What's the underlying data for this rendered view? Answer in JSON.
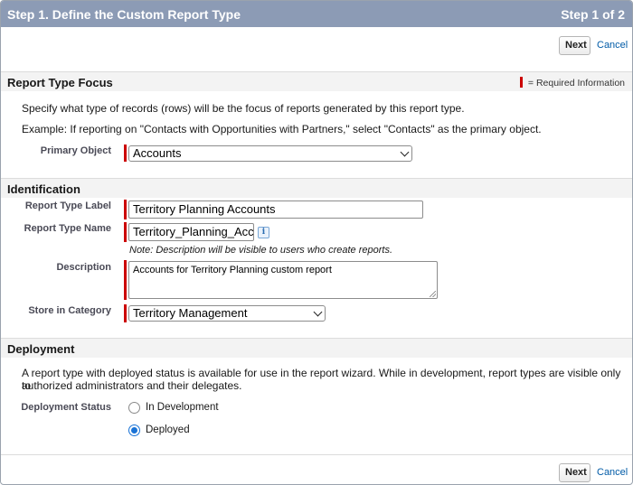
{
  "header": {
    "title": "Step 1. Define the Custom Report Type",
    "step": "Step 1 of 2"
  },
  "buttons": {
    "next_label": "Next",
    "cancel_label": "Cancel"
  },
  "focus": {
    "title": "Report Type Focus",
    "required_legend": "= Required Information",
    "description": "Specify what type of records (rows) will be the focus of reports generated by this report type.",
    "example": "Example: If reporting on \"Contacts with Opportunities with Partners,\" select \"Contacts\" as the primary object.",
    "primary_object_label": "Primary Object",
    "primary_object_value": "Accounts"
  },
  "identification": {
    "title": "Identification",
    "label_label": "Report Type Label",
    "label_value": "Territory Planning Accounts",
    "name_label": "Report Type Name",
    "name_value": "Territory_Planning_Acc",
    "info_icon": "info-icon",
    "note": "Note: Description will be visible to users who create reports.",
    "description_label": "Description",
    "description_value": "Accounts for Territory Planning custom report",
    "category_label": "Store in Category",
    "category_value": "Territory Management"
  },
  "deployment": {
    "title": "Deployment",
    "description_line1": "A report type with deployed status is available for use in the report wizard. While in development, report types are visible only to",
    "description_line2": "authorized administrators and their delegates.",
    "status_label": "Deployment Status",
    "options": [
      {
        "label": "In Development",
        "selected": false
      },
      {
        "label": "Deployed",
        "selected": true
      }
    ]
  },
  "colors": {
    "header_bg": "#8c9bb5",
    "required": "#cc0000",
    "link": "#015ba7",
    "radio_selected": "#1a73d6"
  }
}
